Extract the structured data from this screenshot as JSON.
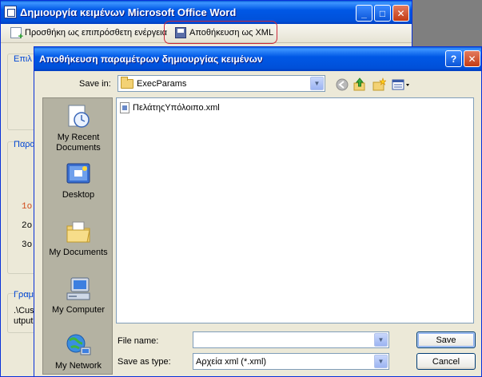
{
  "main_window": {
    "title": "Δημιουργία κειμένων Microsoft Office Word",
    "toolbar": {
      "add_action": "Προσθήκη ως επιπρόσθετη ενέργεια",
      "save_xml": "Αποθήκευση ως XML"
    },
    "partial": {
      "group1": "Επιλ",
      "group2": "Παρα",
      "row1": "1ο",
      "row2": "2ο",
      "row3": "3ο",
      "group3": "Γραμ",
      "path_line1": ".\\Cus",
      "path_line2": "utput"
    }
  },
  "dialog": {
    "title": "Αποθήκευση παραμέτρων δημιουργίας κειμένων",
    "save_in_label": "Save in:",
    "save_in_value": "ExecParams",
    "places": [
      "My Recent Documents",
      "Desktop",
      "My Documents",
      "My Computer",
      "My Network"
    ],
    "files": [
      "ΠελάτηςΥπόλοιπο.xml"
    ],
    "file_name_label": "File name:",
    "file_name_value": "",
    "save_type_label": "Save as type:",
    "save_type_value": "Αρχεία xml (*.xml)",
    "save_button": "Save",
    "cancel_button": "Cancel"
  }
}
